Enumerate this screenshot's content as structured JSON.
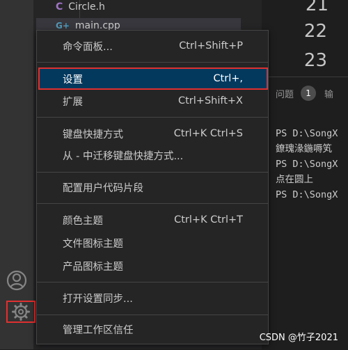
{
  "explorer": {
    "files": [
      {
        "name": "Circle.h",
        "icon": "C"
      },
      {
        "name": "main.cpp",
        "icon": "G+"
      }
    ]
  },
  "editor": {
    "line_numbers": [
      "21",
      "22",
      "23"
    ]
  },
  "panel": {
    "tab_problems": "问题",
    "problems_count": "1",
    "tab_next": "输",
    "terminal_lines": [
      "PS D:\\SongX",
      "鐐瑰湪鍦嗕笂",
      "PS D:\\SongX",
      "点在圆上",
      "PS D:\\SongX"
    ]
  },
  "menu": {
    "items": [
      {
        "label": "命令面板...",
        "shortcut": "Ctrl+Shift+P"
      },
      {
        "label": "设置",
        "shortcut": "Ctrl+,"
      },
      {
        "label": "扩展",
        "shortcut": "Ctrl+Shift+X"
      },
      {
        "label": "键盘快捷方式",
        "shortcut": "Ctrl+K Ctrl+S"
      },
      {
        "label": "从 - 中迁移键盘快捷方式...",
        "shortcut": ""
      },
      {
        "label": "配置用户代码片段",
        "shortcut": ""
      },
      {
        "label": "颜色主题",
        "shortcut": "Ctrl+K Ctrl+T"
      },
      {
        "label": "文件图标主题",
        "shortcut": ""
      },
      {
        "label": "产品图标主题",
        "shortcut": ""
      },
      {
        "label": "打开设置同步...",
        "shortcut": ""
      },
      {
        "label": "管理工作区信任",
        "shortcut": ""
      }
    ]
  },
  "activity_bar": {
    "account_icon": "account-icon",
    "manage_icon": "gear-icon"
  },
  "watermark": "CSDN @竹子2021",
  "colors": {
    "highlight_border": "#e03030",
    "selected_background": "#04395e"
  }
}
